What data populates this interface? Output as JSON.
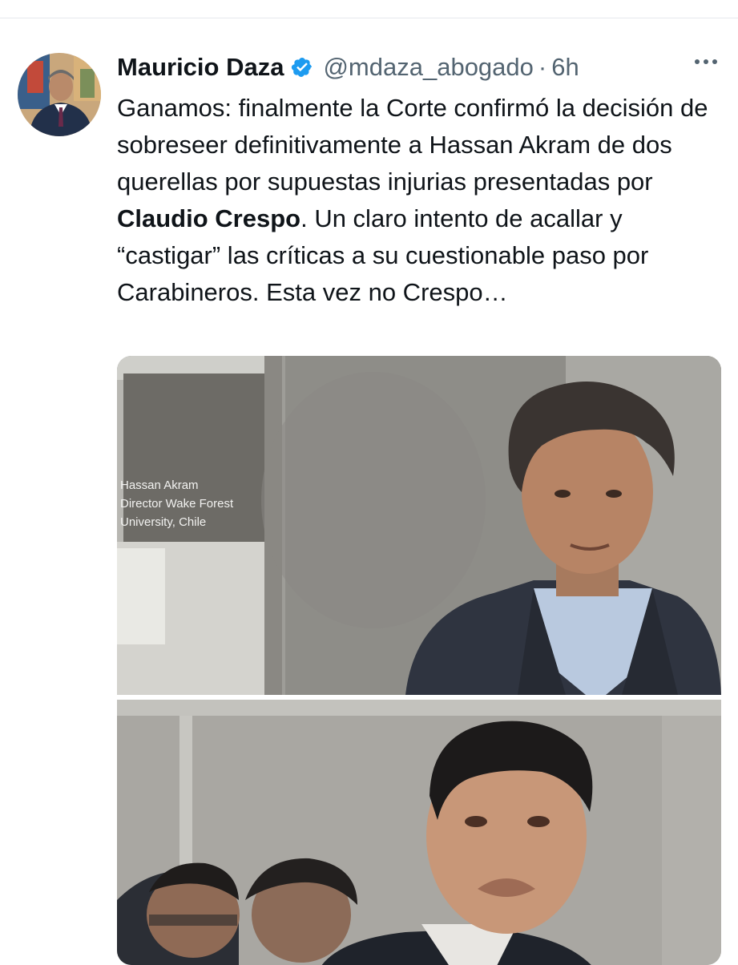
{
  "tweet": {
    "author_name": "Mauricio Daza",
    "handle": "@mdaza_abogado",
    "separator": "·",
    "time": "6h",
    "text_part1": "Ganamos: finalmente la Corte confirmó la decisión de sobreseer definitivamente a Hassan Akram de dos querellas por supuestas injurias presentadas por ",
    "text_bold": "Claudio Crespo",
    "text_part2": ". Un claro intento de acallar y “castigar” las críticas a su cuestionable paso por Carabineros. Esta vez no Crespo…"
  },
  "media": {
    "top_photo_sign": {
      "line1": "Hassan Akram",
      "line2": "Director Wake Forest",
      "line3": "University, Chile"
    }
  },
  "icons": {
    "verified": "verified-badge-icon",
    "more": "more-options-icon"
  },
  "colors": {
    "verified_blue": "#1d9bf0",
    "text_primary": "#0f1419",
    "text_secondary": "#536471"
  }
}
